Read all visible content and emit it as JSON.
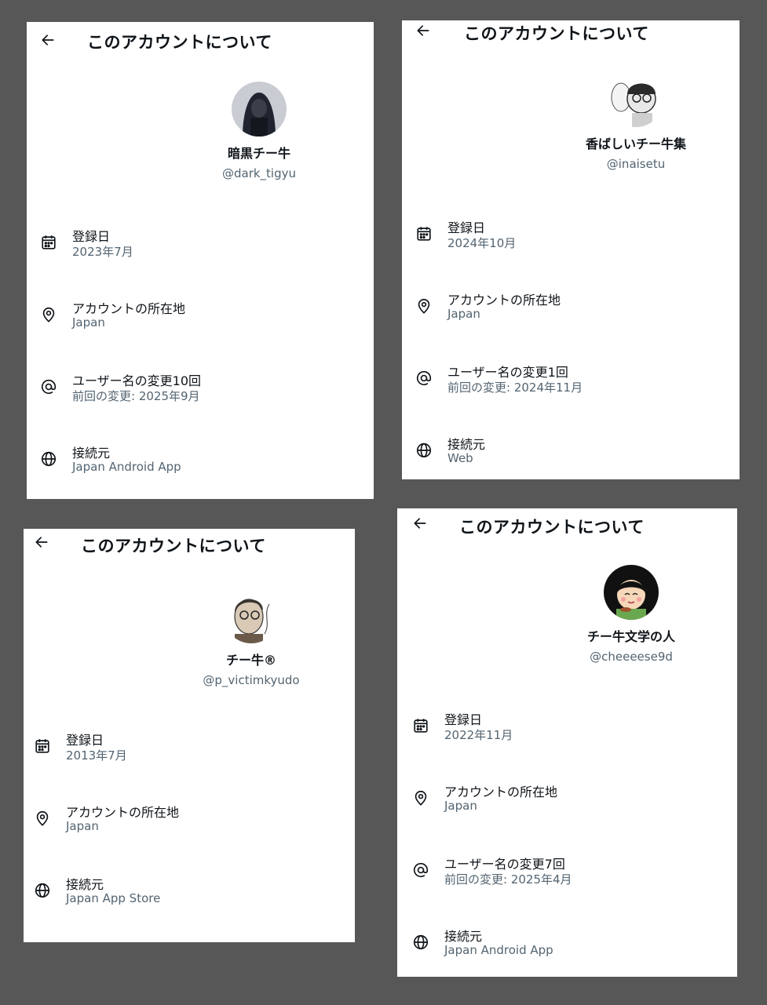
{
  "cards": [
    {
      "header": {
        "title": "このアカウントについて"
      },
      "profile": {
        "display_name": "暗黒チー牛",
        "handle": "@dark_tigyu"
      },
      "rows": {
        "joined": {
          "label": "登録日",
          "value": "2023年7月"
        },
        "location": {
          "label": "アカウントの所在地",
          "value": "Japan"
        },
        "username_changes": {
          "label": "ユーザー名の変更10回",
          "value": "前回の変更: 2025年9月"
        },
        "connected_via": {
          "label": "接続元",
          "value": "Japan Android App"
        }
      }
    },
    {
      "header": {
        "title": "このアカウントについて"
      },
      "profile": {
        "display_name": "香ばしいチー牛集",
        "handle": "@inaisetu"
      },
      "rows": {
        "joined": {
          "label": "登録日",
          "value": "2024年10月"
        },
        "location": {
          "label": "アカウントの所在地",
          "value": "Japan"
        },
        "username_changes": {
          "label": "ユーザー名の変更1回",
          "value": "前回の変更: 2024年11月"
        },
        "connected_via": {
          "label": "接続元",
          "value": "Web"
        }
      }
    },
    {
      "header": {
        "title": "このアカウントについて"
      },
      "profile": {
        "display_name": "チー牛®",
        "handle": "@p_victimkyudo"
      },
      "rows": {
        "joined": {
          "label": "登録日",
          "value": "2013年7月"
        },
        "location": {
          "label": "アカウントの所在地",
          "value": "Japan"
        },
        "connected_via": {
          "label": "接続元",
          "value": "Japan App Store"
        }
      }
    },
    {
      "header": {
        "title": "このアカウントについて"
      },
      "profile": {
        "display_name": "チー牛文学の人",
        "handle": "@cheeeese9d"
      },
      "rows": {
        "joined": {
          "label": "登録日",
          "value": "2022年11月"
        },
        "location": {
          "label": "アカウントの所在地",
          "value": "Japan"
        },
        "username_changes": {
          "label": "ユーザー名の変更7回",
          "value": "前回の変更: 2025年4月"
        },
        "connected_via": {
          "label": "接続元",
          "value": "Japan Android App"
        }
      }
    }
  ],
  "icons": {
    "back": "arrow-left-icon",
    "joined": "calendar-icon",
    "location": "location-pin-icon",
    "username_changes": "at-sign-icon",
    "connected_via": "globe-icon"
  },
  "colors": {
    "background": "#575757",
    "card": "#ffffff",
    "text_primary": "#0f1419",
    "text_secondary": "#536471"
  }
}
